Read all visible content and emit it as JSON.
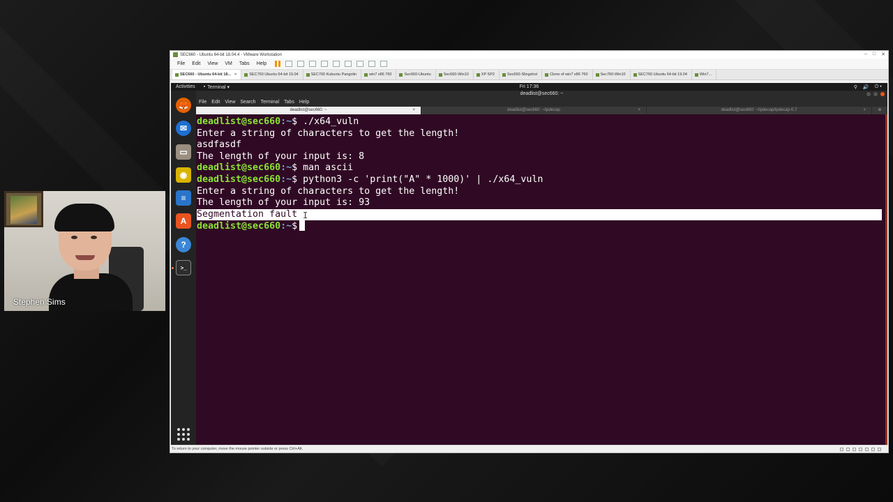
{
  "webcam": {
    "name": "Stephen Sims"
  },
  "vmware": {
    "title": "SEC660 - Ubuntu 64-bit 18.04.4 - VMware Workstation",
    "menu": [
      "File",
      "Edit",
      "View",
      "VM",
      "Tabs",
      "Help"
    ],
    "tabs": [
      {
        "label": "SEC660 - Ubuntu 64-bit 18...",
        "active": true
      },
      {
        "label": "SEC760 Ubuntu 64-bit 19.04"
      },
      {
        "label": "SEC760 Kubuntu Pangolin"
      },
      {
        "label": "win7 x86 760"
      },
      {
        "label": "Sec660-Ubuntu"
      },
      {
        "label": "Sec660-Win10"
      },
      {
        "label": "XP SP2"
      },
      {
        "label": "Sec660-Slingshot"
      },
      {
        "label": "Clone of win7 x86 760"
      },
      {
        "label": "Sec760-Win10"
      },
      {
        "label": "SEC760 Ubuntu 64-bit 19.04"
      },
      {
        "label": "Win7..."
      }
    ],
    "status_text": "To return to your computer, move the mouse pointer outside or press Ctrl+Alt."
  },
  "ubuntu": {
    "activities": "Activities",
    "app_menu": "Terminal ▾",
    "clock": "Fri 17:36",
    "tray": [
      "⚲",
      "🔊",
      "⏻ ▾"
    ]
  },
  "dock": {
    "icons": [
      {
        "name": "firefox-icon",
        "glyph": "🦊",
        "color": "#e66000"
      },
      {
        "name": "thunderbird-icon",
        "glyph": "✉",
        "color": "#1f6fd1"
      },
      {
        "name": "files-icon",
        "glyph": "▭",
        "color": "#9a8f80"
      },
      {
        "name": "rhythmbox-icon",
        "glyph": "◉",
        "color": "#d9b400"
      },
      {
        "name": "writer-icon",
        "glyph": "≡",
        "color": "#2a74c9"
      },
      {
        "name": "software-icon",
        "glyph": "A",
        "color": "#e95420"
      },
      {
        "name": "help-icon",
        "glyph": "?",
        "color": "#3b86d6"
      },
      {
        "name": "terminal-icon",
        "glyph": ">_",
        "color": "#2d2d2d"
      }
    ]
  },
  "terminal": {
    "window_title": "deadlist@sec660: ~",
    "menu": [
      "File",
      "Edit",
      "View",
      "Search",
      "Terminal",
      "Tabs",
      "Help"
    ],
    "tabs": [
      {
        "label": "deadlist@sec660: ~",
        "active": true
      },
      {
        "label": "deadlist@sec660: ~/ipdecap"
      },
      {
        "label": "deadlist@sec660: ~/ipdecap/ipdecap-0.7"
      }
    ],
    "prompt_user": "deadlist@sec660",
    "prompt_path": ":~",
    "prompt_symbol": "$",
    "lines": [
      {
        "type": "cmd",
        "text": "./x64_vuln"
      },
      {
        "type": "out",
        "text": "Enter a string of characters to get the length!"
      },
      {
        "type": "out",
        "text": "asdfasdf"
      },
      {
        "type": "out",
        "text": "The length of your input is: 8"
      },
      {
        "type": "cmd",
        "text": "man ascii"
      },
      {
        "type": "cmd",
        "text": "python3 -c 'print(\"A\" * 1000)' | ./x64_vuln"
      },
      {
        "type": "out",
        "text": "Enter a string of characters to get the length!"
      },
      {
        "type": "out",
        "text": "The length of your input is: 93"
      },
      {
        "type": "highlight",
        "text": "Segmentation fault"
      },
      {
        "type": "cmd",
        "text": ""
      }
    ]
  }
}
